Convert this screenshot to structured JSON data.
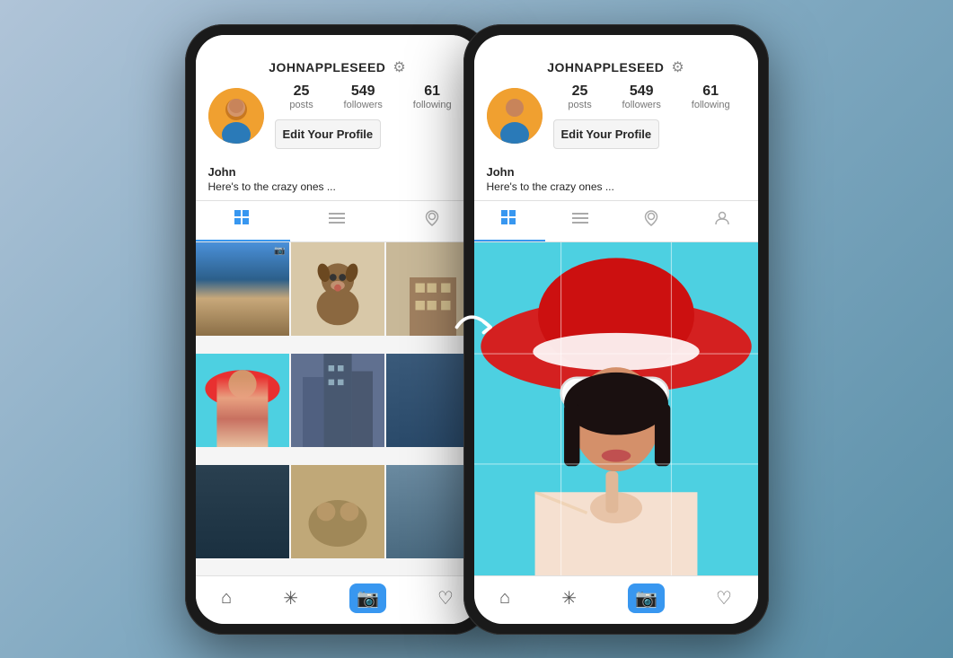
{
  "background_color": "#7fa8c0",
  "phone_left": {
    "username": "JOHNAPPLESEED",
    "stats": {
      "posts": {
        "number": "25",
        "label": "posts"
      },
      "followers": {
        "number": "549",
        "label": "followers"
      },
      "following": {
        "number": "61",
        "label": "following"
      }
    },
    "edit_profile_label": "Edit Your Profile",
    "bio_name": "John",
    "bio_text": "Here's to the crazy ones ...",
    "tabs": [
      "grid",
      "list",
      "location"
    ],
    "bottom_nav": [
      "home",
      "explore",
      "camera",
      "heart"
    ]
  },
  "phone_right": {
    "username": "JOHNAPPLESEED",
    "stats": {
      "posts": {
        "number": "25",
        "label": "posts"
      },
      "followers": {
        "number": "549",
        "label": "followers"
      },
      "following": {
        "number": "61",
        "label": "following"
      }
    },
    "edit_profile_label": "Edit Your Profile",
    "bio_name": "John",
    "bio_text": "Here's to the crazy ones ...",
    "tabs": [
      "grid",
      "list",
      "location",
      "person"
    ],
    "bottom_nav": [
      "home",
      "explore",
      "camera",
      "heart"
    ]
  },
  "icons": {
    "gear": "⚙",
    "home": "⌂",
    "explore": "✳",
    "camera": "📷",
    "heart": "♡",
    "grid": "⊞",
    "list": "≡",
    "location": "📍",
    "person": "👤"
  }
}
